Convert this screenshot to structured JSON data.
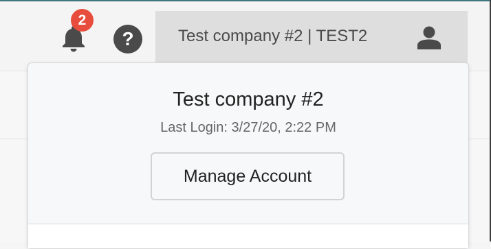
{
  "header": {
    "notifications": {
      "icon": "bell-icon",
      "badge_count": "2",
      "badge_color": "#e74c3c"
    },
    "help": {
      "icon": "help-icon",
      "glyph": "?"
    },
    "account": {
      "label": "Test company #2 | TEST2",
      "icon": "user-icon"
    }
  },
  "dropdown": {
    "company_name": "Test company #2",
    "last_login": "Last Login: 3/27/20, 2:22 PM",
    "manage_account_label": "Manage Account"
  },
  "colors": {
    "top_rule": "#3d7580",
    "badge": "#e74c3c",
    "help_bg": "#4a4a4a",
    "account_bg": "#dedede",
    "icon_dark": "#4a4a4a"
  }
}
